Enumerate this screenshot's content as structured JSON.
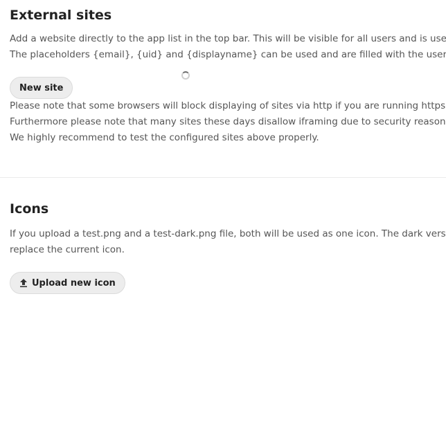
{
  "external_sites": {
    "title": "External sites",
    "description_lines": [
      "Add a website directly to the app list in the top bar. This will be visible for all users and is useful to quic",
      "The placeholders {email}, {uid} and {displayname} can be used and are filled with the user´s values to c"
    ],
    "new_site_label": "New site",
    "notes": [
      "Please note that some browsers will block displaying of sites via http if you are running https.",
      "Furthermore please note that many sites these days disallow iframing due to security reasons.",
      "We highly recommend to test the configured sites above properly."
    ]
  },
  "icons": {
    "title": "Icons",
    "description_lines": [
      "If you upload a test.png and a test-dark.png file, both will be used as one icon. The dark version will be",
      "replace the current icon."
    ],
    "upload_label": "Upload new icon",
    "upload_icon": "upload-icon"
  }
}
